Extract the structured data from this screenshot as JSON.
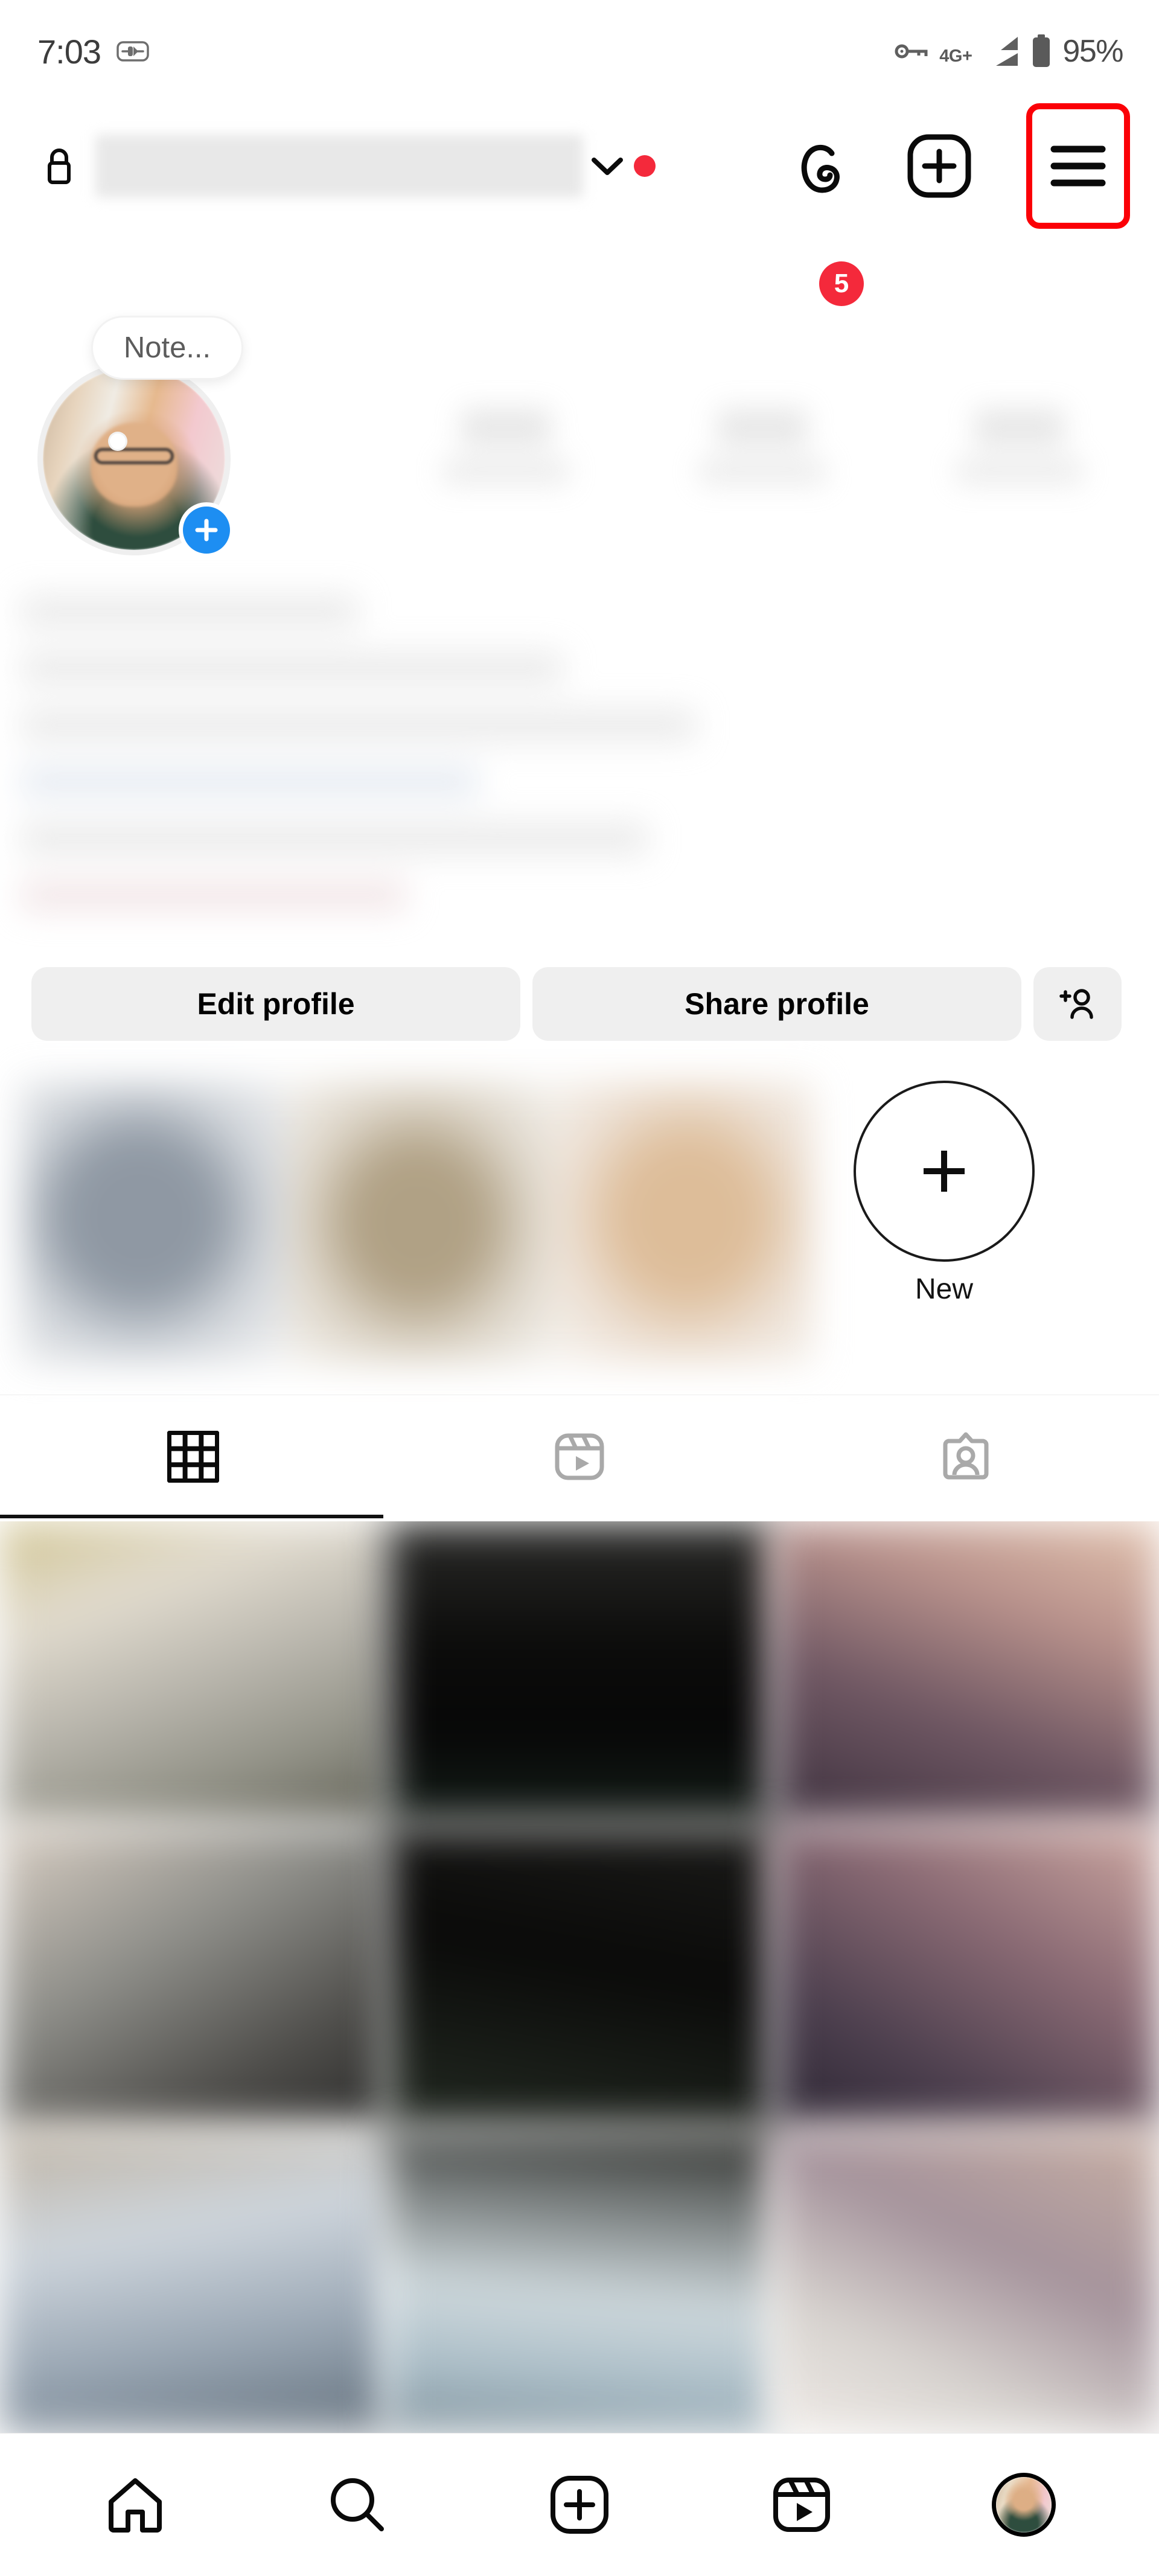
{
  "status_bar": {
    "time": "7:03",
    "alarm_icon": "capsule-icon",
    "vpn_icon": "key-icon",
    "network": "4G+",
    "signal_icon": "signal-bars-icon",
    "battery_icon": "battery-icon",
    "battery_percent": "95%"
  },
  "top_nav": {
    "lock_icon": "lock-icon",
    "username_value": "",
    "username_placeholder": "",
    "chevron_icon": "chevron-down-icon",
    "notification_dot": "",
    "threads_icon": "threads-icon",
    "threads_badge_count": "5",
    "create_icon": "plus-box-icon",
    "menu_icon": "hamburger-menu-icon",
    "menu_highlight_color": "#fb0007"
  },
  "profile": {
    "note_bubble_text": "Note...",
    "avatar_add_icon": "plus-icon",
    "avatar_add_color": "#1d8ef2",
    "stats": [
      {
        "count": "",
        "label": ""
      },
      {
        "count": "",
        "label": ""
      },
      {
        "count": "",
        "label": ""
      }
    ],
    "bio_lines": [
      "",
      "",
      "",
      "",
      "",
      ""
    ]
  },
  "actions": {
    "edit_profile_label": "Edit profile",
    "share_profile_label": "Share profile",
    "add_user_icon": "add-person-icon"
  },
  "highlights": {
    "items": [
      {
        "label": ""
      },
      {
        "label": ""
      },
      {
        "label": ""
      }
    ],
    "new_label": "New",
    "new_icon": "plus-icon"
  },
  "tabs": [
    {
      "icon": "grid-icon",
      "active": true
    },
    {
      "icon": "reels-icon",
      "active": false
    },
    {
      "icon": "tagged-icon",
      "active": false
    }
  ],
  "grid_posts": [
    {
      "id": "post-1"
    },
    {
      "id": "post-2"
    },
    {
      "id": "post-3"
    },
    {
      "id": "post-4"
    },
    {
      "id": "post-5"
    },
    {
      "id": "post-6"
    },
    {
      "id": "post-7"
    },
    {
      "id": "post-8"
    },
    {
      "id": "post-9"
    }
  ],
  "bottom_nav": [
    {
      "icon": "home-icon"
    },
    {
      "icon": "search-icon"
    },
    {
      "icon": "create-icon"
    },
    {
      "icon": "reels-icon"
    },
    {
      "icon": "profile-avatar"
    }
  ],
  "colors": {
    "accent_red": "#f4293b",
    "highlight_red": "#fb0007",
    "blue": "#1d8ef2",
    "button_gray": "#efefef",
    "text_primary": "#000000"
  }
}
